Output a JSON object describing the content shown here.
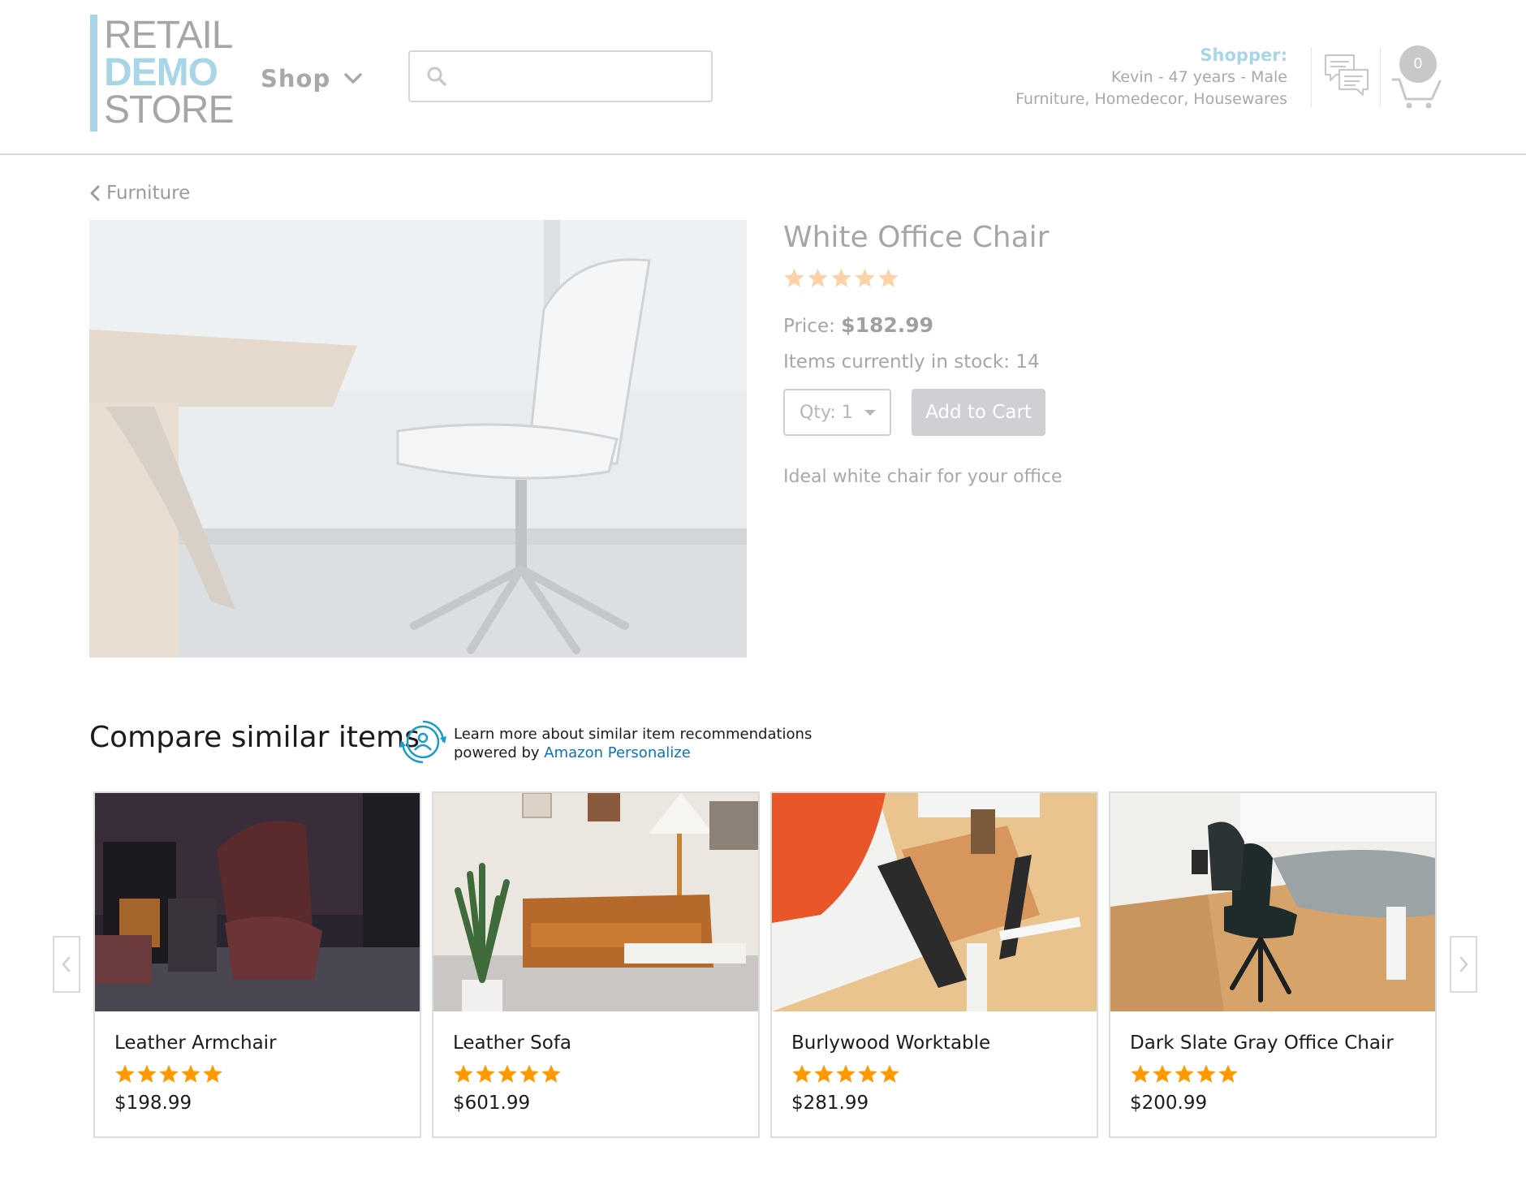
{
  "header": {
    "logo": {
      "line1": "RETAIL",
      "line2": "DEMO",
      "line3": "STORE"
    },
    "shop_label": "Shop",
    "search": {
      "placeholder": "",
      "value": ""
    },
    "shopper": {
      "title": "Shopper:",
      "profile": "Kevin - 47 years - Male",
      "interests": "Furniture, Homedecor, Housewares"
    },
    "cart_count": "0"
  },
  "breadcrumb": {
    "label": "Furniture"
  },
  "product": {
    "name": "White Office Chair",
    "rating": 5,
    "price_label": "Price:",
    "price": "$182.99",
    "stock": "Items currently in stock: 14",
    "qty": "Qty: 1",
    "add_to_cart": "Add to Cart",
    "description": "Ideal white chair for your office"
  },
  "similar": {
    "title": "Compare similar items",
    "info_line1": "Learn more about similar item recommendations",
    "info_powered": "powered by ",
    "info_link": "Amazon Personalize",
    "items": [
      {
        "name": "Leather Armchair",
        "rating": 5,
        "price": "$198.99"
      },
      {
        "name": "Leather Sofa",
        "rating": 5,
        "price": "$601.99"
      },
      {
        "name": "Burlywood Worktable",
        "rating": 5,
        "price": "$281.99"
      },
      {
        "name": "Dark Slate Gray Office Chair",
        "rating": 5,
        "price": "$200.99"
      }
    ]
  },
  "colors": {
    "brand_blue": "#a9d6e7",
    "star_orange": "#ff9900",
    "star_faded": "#fcd3a6",
    "link_blue": "#0b73bb",
    "button_gray": "#cfd0d4"
  },
  "icons": {
    "search": "search-icon",
    "shop_chevron": "chevron-down-icon",
    "chat": "chat-icon",
    "cart": "cart-icon",
    "breadcrumb": "chevron-left-icon",
    "personalize": "personalize-icon",
    "carousel_prev": "chevron-left-icon",
    "carousel_next": "chevron-right-icon"
  }
}
